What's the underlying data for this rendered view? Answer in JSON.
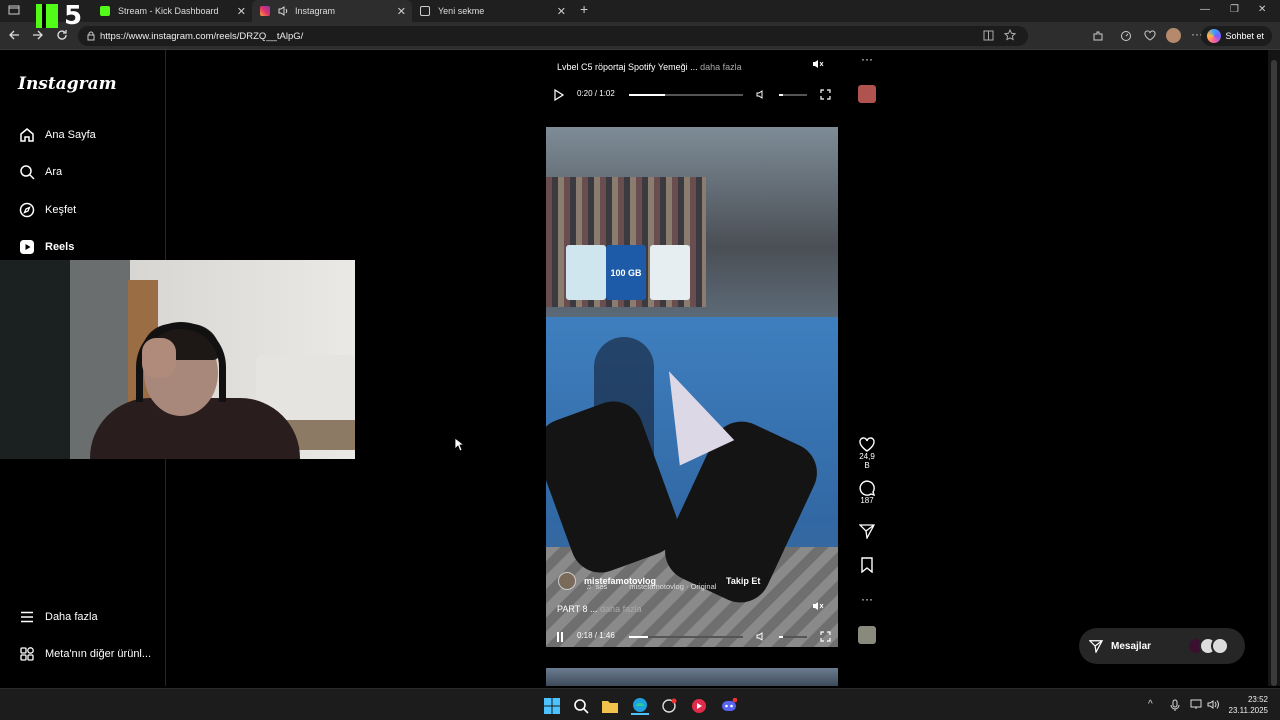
{
  "browser": {
    "tabs": [
      {
        "title": "Stream - Kick Dashboard",
        "favicon": "kick-icon",
        "color": "#53fc18"
      },
      {
        "title": "Instagram",
        "favicon": "instagram-icon",
        "color": "#e1306c"
      },
      {
        "title": "Yeni sekme",
        "favicon": "new-tab-icon",
        "color": "#cccccc"
      }
    ],
    "url": "https://www.instagram.com/reels/DRZQ__tAlpG/",
    "chat_button": "Sohbet et"
  },
  "overlay_logo": {
    "number": "5"
  },
  "sidebar": {
    "logo": "Instagram",
    "items": [
      {
        "label": "Ana Sayfa",
        "icon": "home-icon"
      },
      {
        "label": "Ara",
        "icon": "search-icon"
      },
      {
        "label": "Keşfet",
        "icon": "compass-icon"
      },
      {
        "label": "Reels",
        "icon": "reels-icon"
      }
    ],
    "bottom_items": [
      {
        "label": "Daha fazla",
        "icon": "menu-icon"
      },
      {
        "label": "Meta'nın diğer ürünl...",
        "icon": "meta-apps-icon"
      }
    ]
  },
  "reel_previous": {
    "caption": "Lvbel C5 röportaj Spotify Yemeği ...",
    "more": "daha fazla",
    "time": "0:20 / 1:02",
    "progress": 0.32
  },
  "reel_current": {
    "username": "mistefamotovlog",
    "follow": "Takip Et",
    "audio_prefix": "ses",
    "audio": "mistefamotovlog · Original",
    "caption": "PART 8 ...",
    "more": "daha fazla",
    "time": "0:18 / 1:46",
    "progress": 0.17,
    "likes": "24,9 B",
    "comments": "187",
    "ad_text": "100 GB"
  },
  "messages": {
    "label": "Mesajlar"
  },
  "taskbar": {
    "time": "23:52",
    "date": "23.11.2025"
  },
  "colors": {
    "accent": "#0095f6",
    "kick": "#53fc18"
  }
}
